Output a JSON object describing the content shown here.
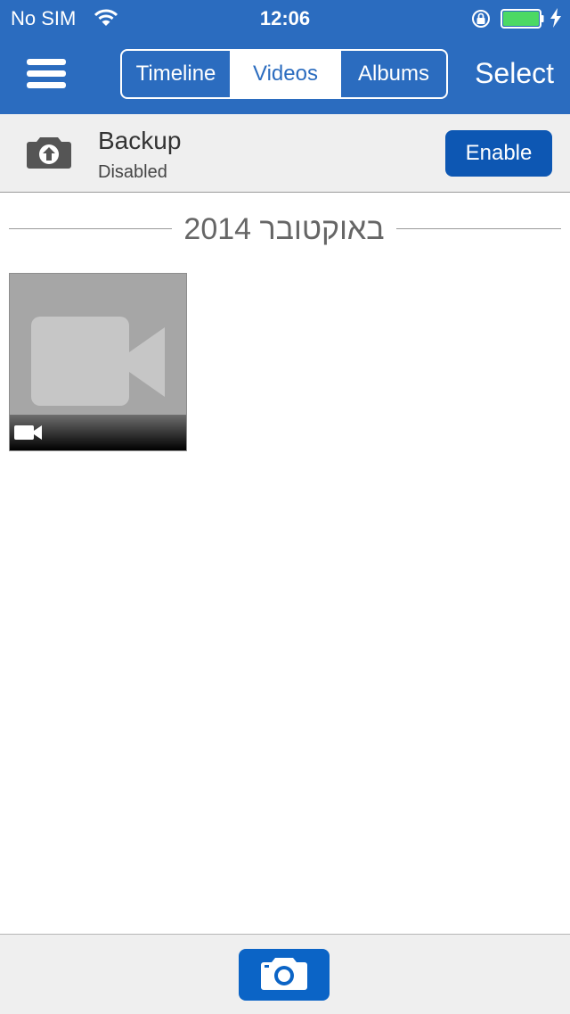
{
  "status_bar": {
    "carrier": "No SIM",
    "time": "12:06",
    "battery_level": 1.0,
    "icons": [
      "wifi-icon",
      "rotation-lock-icon",
      "battery-icon",
      "charging-bolt-icon"
    ]
  },
  "nav": {
    "menu_icon": "hamburger-menu-icon",
    "tabs": [
      {
        "label": "Timeline",
        "selected": false
      },
      {
        "label": "Videos",
        "selected": true
      },
      {
        "label": "Albums",
        "selected": false
      }
    ],
    "select_label": "Select"
  },
  "backup": {
    "icon": "camera-upload-icon",
    "title": "Backup",
    "status": "Disabled",
    "enable_label": "Enable"
  },
  "section": {
    "title": "באוקטובר 2014"
  },
  "media": {
    "items": [
      {
        "type": "video",
        "thumbnail_icon": "video-placeholder-icon",
        "badge_icon": "video-camera-icon"
      }
    ]
  },
  "bottom_bar": {
    "camera_icon": "camera-icon"
  },
  "colors": {
    "header": "#2b6cbf",
    "enable_button": "#0d57b3",
    "camera_button": "#0b64c6",
    "battery_fill": "#4cd964"
  }
}
